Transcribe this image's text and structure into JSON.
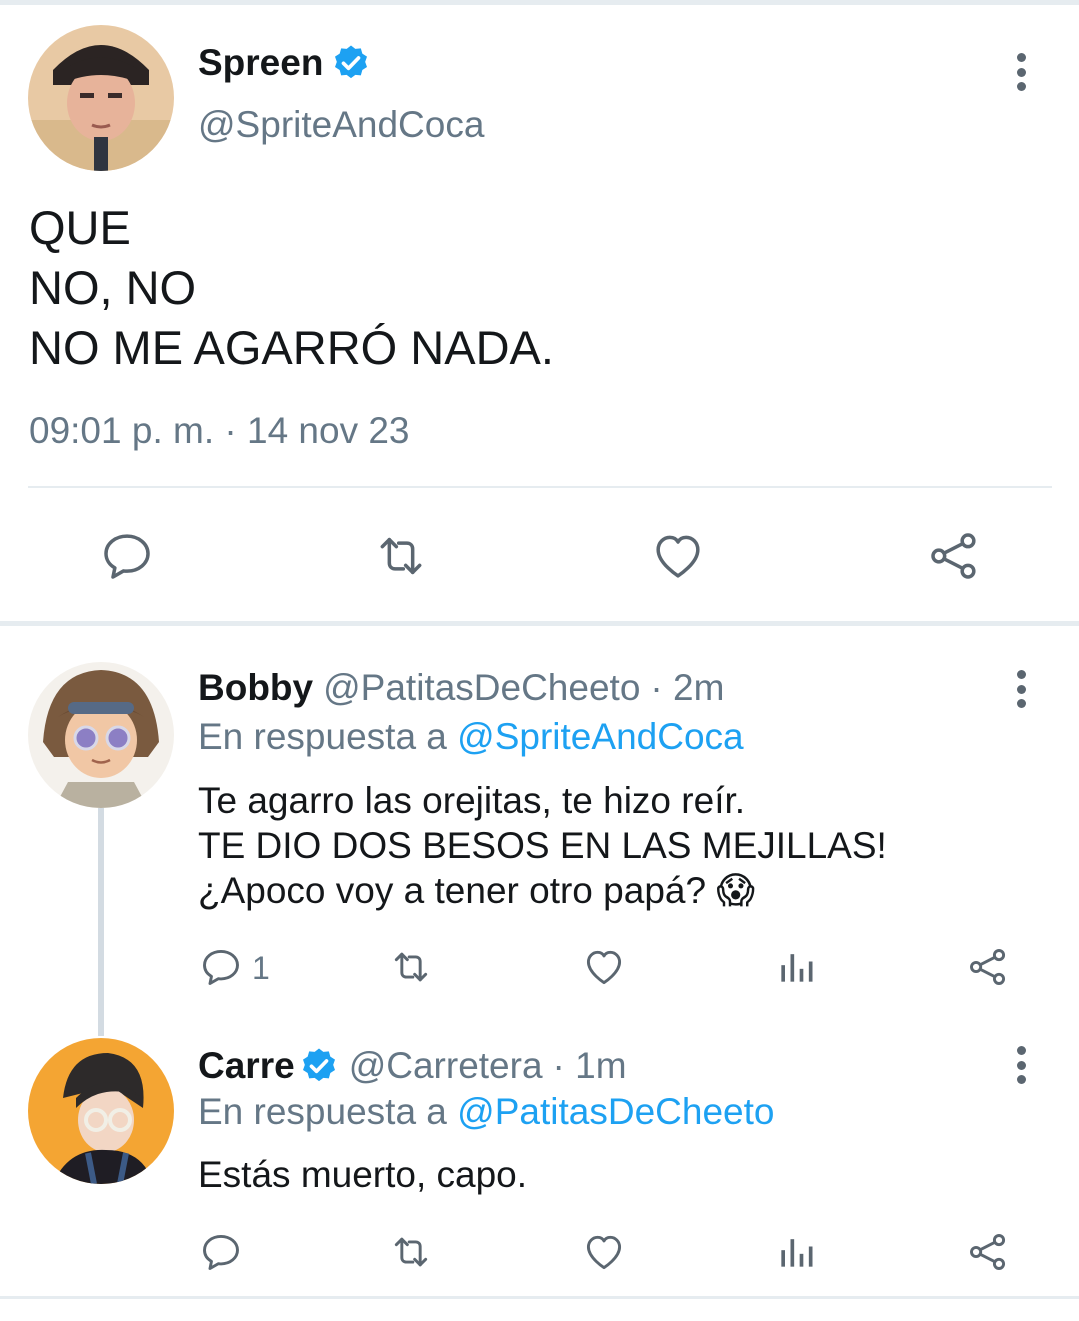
{
  "main_tweet": {
    "name": "Spreen",
    "verified": true,
    "handle": "@SpriteAndCoca",
    "lines": [
      "QUE",
      "NO, NO",
      "NO ME AGARRÓ NADA."
    ],
    "timestamp": "09:01 p. m. · 14 nov 23",
    "actions": [
      "reply-icon",
      "retweet-icon",
      "like-icon",
      "share-icon"
    ]
  },
  "replies": [
    {
      "name": "Bobby",
      "verified": false,
      "handle": "@PatitasDeCheeto",
      "time": "· 2m",
      "reply_prefix": "En respuesta a",
      "reply_to": "@SpriteAndCoca",
      "lines": [
        "Te agarro las orejitas, te hizo reír.",
        "TE DIO DOS BESOS EN LAS MEJILLAS!",
        "¿Apoco voy a tener otro papá?"
      ],
      "emoji": "😱",
      "reply_count": "1"
    },
    {
      "name": "Carre",
      "verified": true,
      "handle": "@Carretera",
      "time": "· 1m",
      "reply_prefix": "En respuesta a",
      "reply_to": "@PatitasDeCheeto",
      "lines": [
        "Estás muerto, capo."
      ],
      "reply_count": ""
    }
  ],
  "colors": {
    "accent": "#1da1f2",
    "icon": "#5b6670",
    "secondary_text": "#657786",
    "divider": "#e6ecf0"
  }
}
